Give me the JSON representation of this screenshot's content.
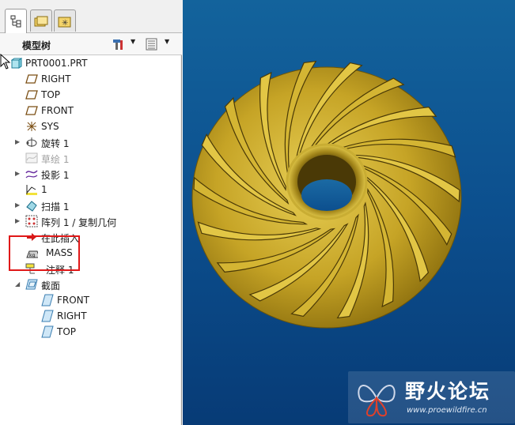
{
  "panel": {
    "title": "模型树"
  },
  "tree": {
    "items": [
      {
        "label": "PRT0001.PRT"
      },
      {
        "label": "RIGHT"
      },
      {
        "label": "TOP"
      },
      {
        "label": "FRONT"
      },
      {
        "label": "SYS"
      },
      {
        "label": "旋转 1"
      },
      {
        "label": "草绘 1"
      },
      {
        "label": "投影 1"
      },
      {
        "label": "1"
      },
      {
        "label": "扫描 1"
      },
      {
        "label": "阵列 1 / 复制几何"
      },
      {
        "label": "在此插入"
      },
      {
        "label": "MASS"
      },
      {
        "label": "注释 1"
      },
      {
        "label": "截面"
      },
      {
        "label": "FRONT"
      },
      {
        "label": "RIGHT"
      },
      {
        "label": "TOP"
      }
    ]
  },
  "watermark": {
    "name": "野火论坛",
    "url": "www.proewildfire.cn"
  },
  "colors": {
    "viewport_bg": "#0c4f8e",
    "part_gold": "#c8a828",
    "highlight_red": "#e01818"
  }
}
